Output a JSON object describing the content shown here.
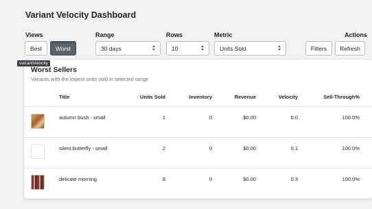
{
  "page": {
    "title": "Variant Velocity Dashboard"
  },
  "controls": {
    "views_label": "Views",
    "views": {
      "best_label": "Best",
      "worst_label": "Worst",
      "active": "Worst"
    },
    "range": {
      "label": "Range",
      "value": "30 days"
    },
    "rows": {
      "label": "Rows",
      "value": "10"
    },
    "metric": {
      "label": "Metric",
      "value": "Units Sold"
    },
    "actions_label": "Actions",
    "filters_label": "Filters",
    "refresh_label": "Refresh"
  },
  "tooltip": {
    "text": "variantVelocity"
  },
  "card": {
    "title": "Worst Sellers",
    "subtitle": "Variants with the lowest units sold in selected range"
  },
  "table": {
    "columns": {
      "title": "Title",
      "units_sold": "Units Sold",
      "inventory": "Inventory",
      "revenue": "Revenue",
      "velocity": "Velocity",
      "sell_through": "Sell-Through%"
    },
    "sort_indicator": "↑",
    "rows": [
      {
        "title": "autumn bush - small",
        "units_sold": "1",
        "inventory": "0",
        "revenue": "$0.00",
        "velocity": "0.0",
        "sell_through": "100.0%"
      },
      {
        "title": "silent butterfly - small",
        "units_sold": "2",
        "inventory": "0",
        "revenue": "$0.00",
        "velocity": "0.1",
        "sell_through": "100.0%"
      },
      {
        "title": "delicate morning",
        "units_sold": "8",
        "inventory": "0",
        "revenue": "$0.00",
        "velocity": "0.3",
        "sell_through": "100.0%"
      }
    ]
  }
}
